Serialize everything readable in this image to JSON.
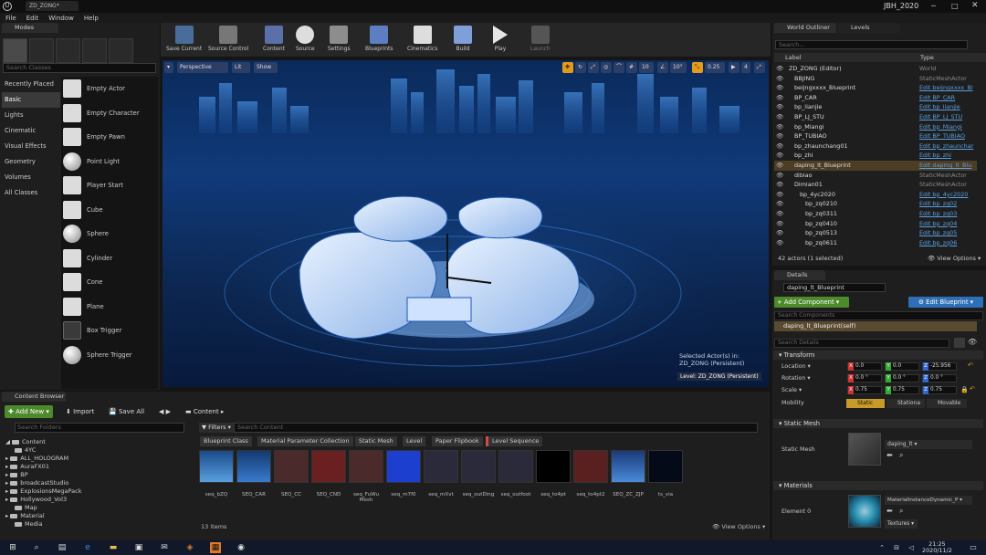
{
  "window": {
    "doc_tab": "ZD_ZONG*",
    "project": "JBH_2020"
  },
  "menu": [
    "File",
    "Edit",
    "Window",
    "Help"
  ],
  "modes": {
    "tab": "Modes",
    "search_placeholder": "Search Classes",
    "categories": [
      "Recently Placed",
      "Basic",
      "Lights",
      "Cinematic",
      "Visual Effects",
      "Geometry",
      "Volumes",
      "All Classes"
    ],
    "selected_category": "Basic",
    "placeables": [
      "Empty Actor",
      "Empty Character",
      "Empty Pawn",
      "Point Light",
      "Player Start",
      "Cube",
      "Sphere",
      "Cylinder",
      "Cone",
      "Plane",
      "Box Trigger",
      "Sphere Trigger"
    ]
  },
  "toolbar": [
    "Save Current",
    "Source Control",
    "Content",
    "Source",
    "Settings",
    "Blueprints",
    "Cinematics",
    "Build",
    "Play",
    "Launch"
  ],
  "viewport": {
    "perspective": "Perspective",
    "lit": "Lit",
    "show": "Show",
    "grid_snap": "10",
    "rot_snap": "10°",
    "scale_snap": "0.25",
    "cam_speed": "4",
    "selected_line1": "Selected Actor(s) in:",
    "selected_line2": "ZD_ZONG (Persistent)",
    "level_label": "Level:  ZD_ZONG (Persistent)"
  },
  "content_browser": {
    "tab": "Content Browser",
    "add_new": "Add New",
    "import": "Import",
    "save_all": "Save All",
    "path": "Content",
    "search_folders": "Search Folders",
    "filters": "Filters",
    "search_content": "Search Content",
    "folders": [
      "Content",
      "4YC",
      "ALL_HOLOGRAM",
      "AuraFX01",
      "BP",
      "broadcastStudio",
      "ExplosionsMegaPack",
      "Hollywood_Vol3",
      "Map",
      "Material",
      "Media"
    ],
    "chips": [
      "Blueprint Class",
      "Material Parameter Collection",
      "Static Mesh",
      "Level",
      "Paper Flipbook",
      "Level Sequence"
    ],
    "assets": [
      "seq_bZQ",
      "SEQ_CAR",
      "SEQ_CC",
      "SEQ_CND",
      "seq_FuWu Mesh",
      "seq_m7f0",
      "seq_mXvt",
      "seq_outDing",
      "seq_outfoot",
      "seq_to4pt",
      "seq_to4pt2",
      "SEQ_ZC_ZJP",
      "ts_via"
    ],
    "items_count": "13 items",
    "view_options": "View Options"
  },
  "outliner": {
    "tabs": [
      "World Outliner",
      "Levels"
    ],
    "search_placeholder": "Search...",
    "col_label": "Label",
    "col_type": "Type",
    "rows": [
      {
        "label": "ZD_ZONG (Editor)",
        "type": "World",
        "link": false,
        "indent": 0
      },
      {
        "label": "BBJING",
        "type": "StaticMeshActor",
        "link": false,
        "indent": 1
      },
      {
        "label": "beijngxxxx_Blueprint",
        "type": "Edit beijngxxxx_Bl",
        "link": true,
        "indent": 1
      },
      {
        "label": "BP_CAR",
        "type": "Edit BP_CAR",
        "link": true,
        "indent": 1
      },
      {
        "label": "bp_lianjie",
        "type": "Edit bp_lianjie",
        "link": true,
        "indent": 1
      },
      {
        "label": "BP_LJ_STU",
        "type": "Edit BP_LJ_STU",
        "link": true,
        "indent": 1
      },
      {
        "label": "bp_Miangi",
        "type": "Edit bp_Miangi",
        "link": true,
        "indent": 1
      },
      {
        "label": "BP_TUBIAO",
        "type": "Edit BP_TUBIAO",
        "link": true,
        "indent": 1
      },
      {
        "label": "bp_zhaunchang01",
        "type": "Edit bp_zhaunchar",
        "link": true,
        "indent": 1
      },
      {
        "label": "bp_zhi",
        "type": "Edit bp_zhi",
        "link": true,
        "indent": 1
      },
      {
        "label": "daping_lt_Blueprint",
        "type": "Edit daping_lt_Blu",
        "link": true,
        "indent": 1
      },
      {
        "label": "dibiao",
        "type": "StaticMeshActor",
        "link": false,
        "indent": 1
      },
      {
        "label": "Dimian01",
        "type": "StaticMeshActor",
        "link": false,
        "indent": 1
      },
      {
        "label": "bp_4yc2020",
        "type": "Edit bp_4yc2020",
        "link": true,
        "indent": 2
      },
      {
        "label": "bp_zq0210",
        "type": "Edit bp_zq02",
        "link": true,
        "indent": 3
      },
      {
        "label": "bp_zq0311",
        "type": "Edit bp_zq03",
        "link": true,
        "indent": 3
      },
      {
        "label": "bp_zq0410",
        "type": "Edit bp_zq04",
        "link": true,
        "indent": 3
      },
      {
        "label": "bp_zq0513",
        "type": "Edit bp_zq05",
        "link": true,
        "indent": 3
      },
      {
        "label": "bp_zq0611",
        "type": "Edit bp_zq06",
        "link": true,
        "indent": 3
      }
    ],
    "selected_row": 10,
    "count": "42 actors (1 selected)",
    "view_options": "View Options"
  },
  "details": {
    "tab": "Details",
    "name": "daping_lt_Blueprint",
    "add_component": "+ Add Component ▾",
    "edit_blueprint": "⚙ Edit Blueprint ▾",
    "search_components": "Search Components",
    "self_row": "daping_lt_Blueprint(self)",
    "search_details": "Search Details",
    "transform": "Transform",
    "location": {
      "label": "Location ▾",
      "x": "0.0",
      "y": "0.0",
      "z": "-25.956"
    },
    "rotation": {
      "label": "Rotation ▾",
      "x": "0.0 °",
      "y": "0.0 °",
      "z": "0.0 °"
    },
    "scale": {
      "label": "Scale ▾",
      "x": "0.75",
      "y": "0.75",
      "z": "0.75"
    },
    "mobility": {
      "label": "Mobility",
      "options": [
        "Static",
        "Stationa",
        "Movable"
      ],
      "selected": "Static"
    },
    "static_mesh_section": "Static Mesh",
    "static_mesh_label": "Static Mesh",
    "static_mesh_value": "daping_lt",
    "materials_section": "Materials",
    "element0_label": "Element 0",
    "material_value": "MaterialInstanceDynamic_P",
    "textures": "Textures ▾"
  },
  "taskbar": {
    "time": "21:25",
    "date": "2020/11/2"
  }
}
